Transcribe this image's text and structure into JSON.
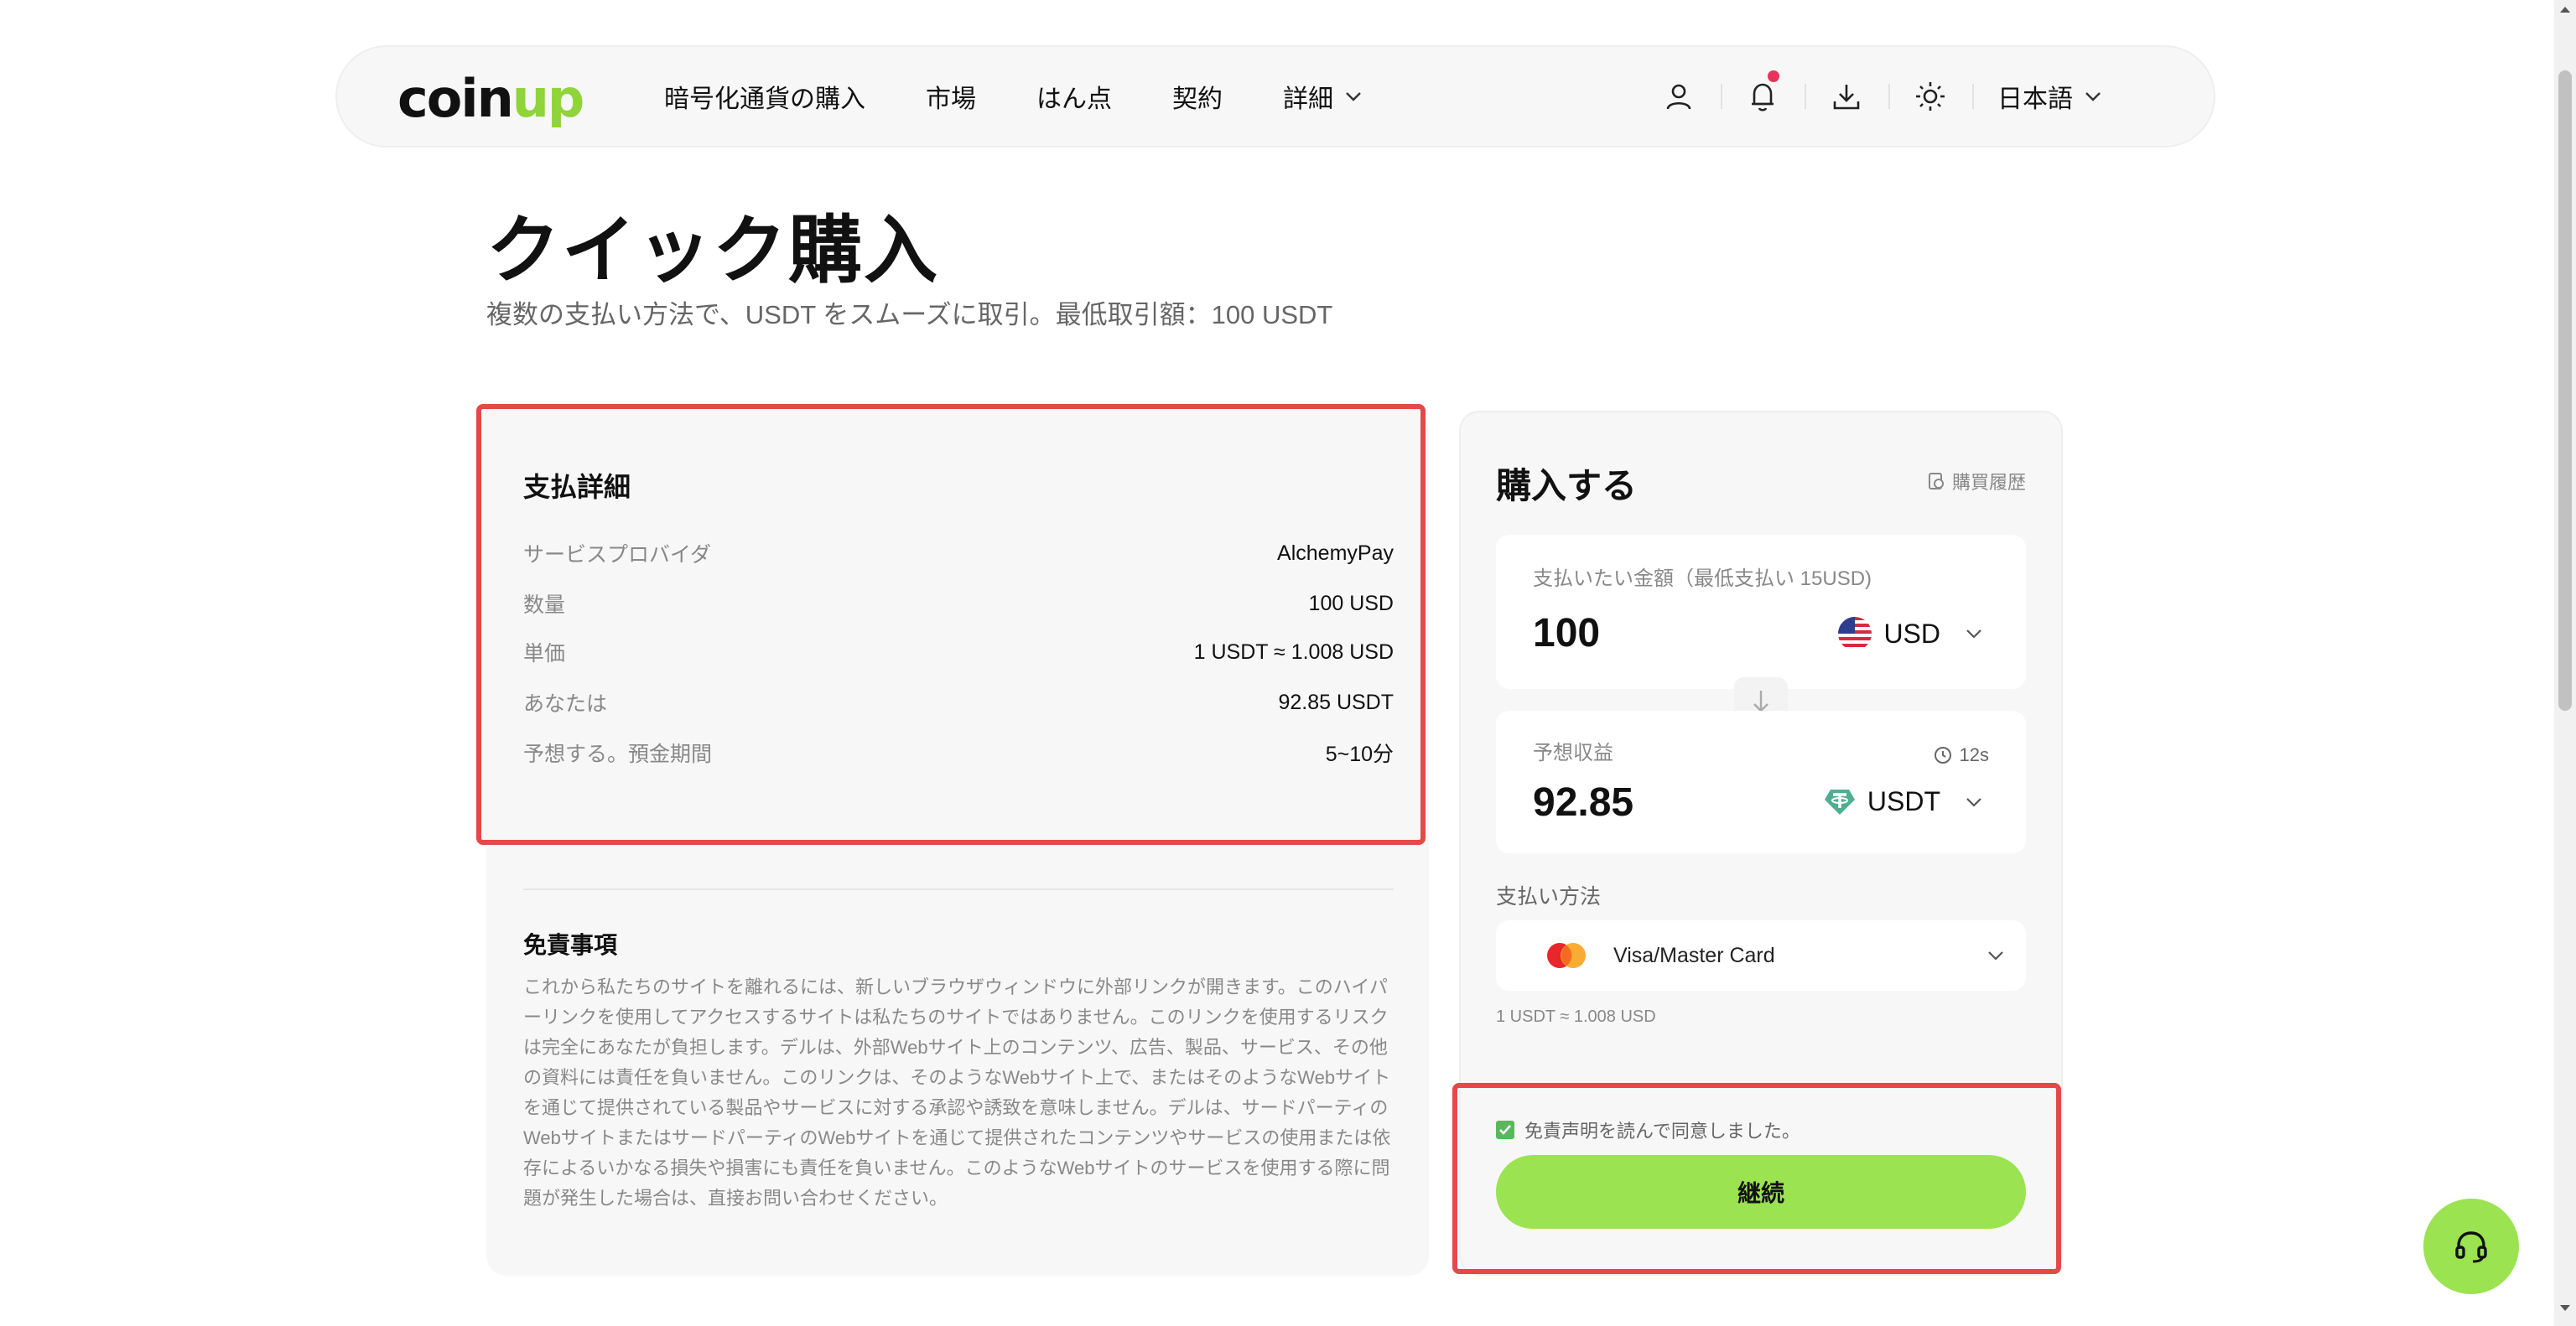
{
  "header": {
    "logo_prefix": "coin",
    "logo_accent": "up",
    "nav": [
      {
        "label": "暗号化通貨の購入"
      },
      {
        "label": "市場"
      },
      {
        "label": "はん点"
      },
      {
        "label": "契約"
      },
      {
        "label": "詳細"
      }
    ],
    "language": "日本語"
  },
  "page": {
    "title": "クイック購入",
    "subtitle": "複数の支払い方法で、USDT をスムーズに取引。最低取引額：100 USDT"
  },
  "payment_details": {
    "title": "支払詳細",
    "rows": [
      {
        "key": "サービスプロバイダ",
        "value": "AlchemyPay"
      },
      {
        "key": "数量",
        "value": "100 USD"
      },
      {
        "key": "単価",
        "value": "1 USDT ≈ 1.008 USD"
      },
      {
        "key": "あなたは",
        "value": "92.85 USDT"
      },
      {
        "key": "予想する。預金期間",
        "value": "5~10分"
      }
    ]
  },
  "disclaimer": {
    "title": "免責事項",
    "text": "これから私たちのサイトを離れるには、新しいブラウザウィンドウに外部リンクが開きます。このハイパーリンクを使用してアクセスするサイトは私たちのサイトではありません。このリンクを使用するリスクは完全にあなたが負担します。デルは、外部Webサイト上のコンテンツ、広告、製品、サービス、その他の資料には責任を負いません。このリンクは、そのようなWebサイト上で、またはそのようなWebサイトを通じて提供されている製品やサービスに対する承認や誘致を意味しません。デルは、サードパーティのWebサイトまたはサードパーティのWebサイトを通じて提供されたコンテンツやサービスの使用または依存によるいかなる損失や損害にも責任を負いません。このようなWebサイトのサービスを使用する際に問題が発生した場合は、直接お問い合わせください。"
  },
  "buy": {
    "title": "購入する",
    "history_label": "購買履歴",
    "pay": {
      "label": "支払いたい金額（最低支払い 15USD)",
      "amount": "100",
      "currency": "USD"
    },
    "receive": {
      "label": "予想収益",
      "timer": "12s",
      "amount": "92.85",
      "currency": "USDT"
    },
    "payment_method_label": "支払い方法",
    "payment_method": "Visa/Master Card",
    "rate": "1 USDT ≈ 1.008 USD",
    "agree_text": "免責声明を読んで同意しました。",
    "continue_label": "継続"
  },
  "colors": {
    "accent": "#9be351",
    "highlight": "#e54848",
    "notification_dot": "#e8345a"
  }
}
